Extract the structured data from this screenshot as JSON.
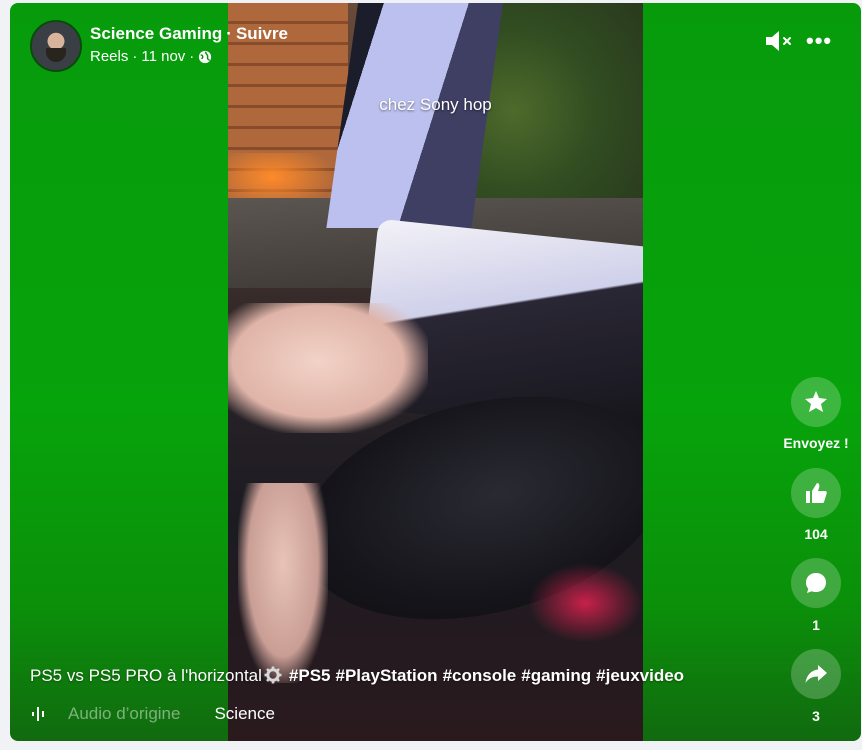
{
  "header": {
    "channel_name": "Science Gaming",
    "separator": "·",
    "follow_label": "Suivre",
    "meta_reels": "Reels",
    "meta_dot1": "·",
    "meta_date": "11 nov",
    "meta_dot2": "·",
    "privacy_icon": "globe-icon"
  },
  "video": {
    "caption": "chez Sony hop"
  },
  "controls": {
    "mute_icon": "speaker-muted-icon",
    "more_icon": "more-options-icon",
    "more_glyph": "•••"
  },
  "rail": {
    "send": {
      "label": "Envoyez !",
      "icon": "sparkle-star-icon"
    },
    "like": {
      "count": "104",
      "icon": "thumbs-up-icon"
    },
    "comment": {
      "count": "1",
      "icon": "comment-bubble-icon"
    },
    "share": {
      "count": "3",
      "icon": "share-arrow-icon"
    }
  },
  "description": {
    "text": "PS5 vs PS5 PRO à l'horizontal",
    "emoji_icon": "gear-icon",
    "hashtags": [
      "#PS5",
      "#PlayStation",
      "#console",
      "#gaming",
      "#jeuxvideo"
    ]
  },
  "audio": {
    "icon": "audio-wave-icon",
    "label": "Audio d’origine",
    "creator": "Science"
  },
  "colors": {
    "background_green": "#07a30b",
    "page_bg": "#f0f2f5"
  }
}
